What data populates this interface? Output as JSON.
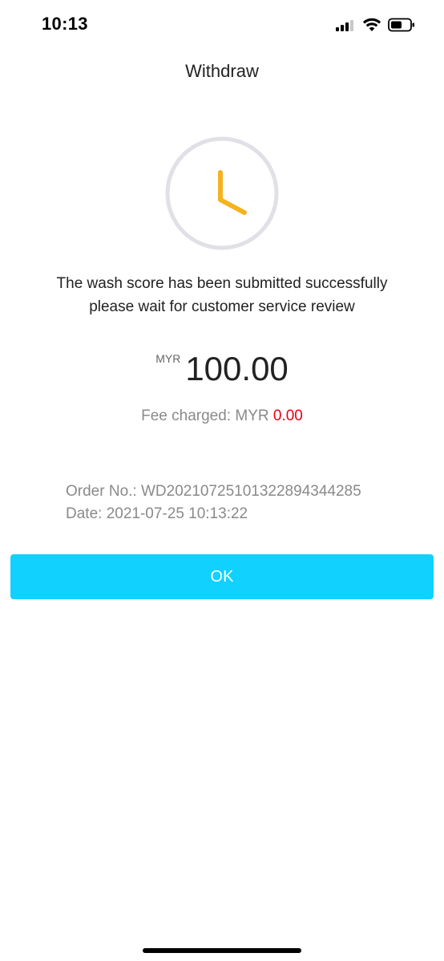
{
  "status_bar": {
    "time": "10:13",
    "icons": [
      "cellular-signal-icon",
      "wifi-icon",
      "battery-icon"
    ]
  },
  "header": {
    "title": "Withdraw"
  },
  "status_icon": {
    "name": "clock-pending-icon",
    "ring_color": "#e0e0e6",
    "hands_color": "#f5b320"
  },
  "message": {
    "line1": "The wash score has been submitted successfully",
    "line2": "please wait for customer service review"
  },
  "amount": {
    "currency": "MYR",
    "value": "100.00"
  },
  "fee": {
    "label": "Fee charged: MYR ",
    "value": "0.00",
    "value_color": "#e60012"
  },
  "order": {
    "order_no": "Order No.: WD20210725101322894344285",
    "date": "Date: 2021-07-25 10:13:22"
  },
  "actions": {
    "ok_label": "OK",
    "ok_color": "#10d1ff"
  }
}
